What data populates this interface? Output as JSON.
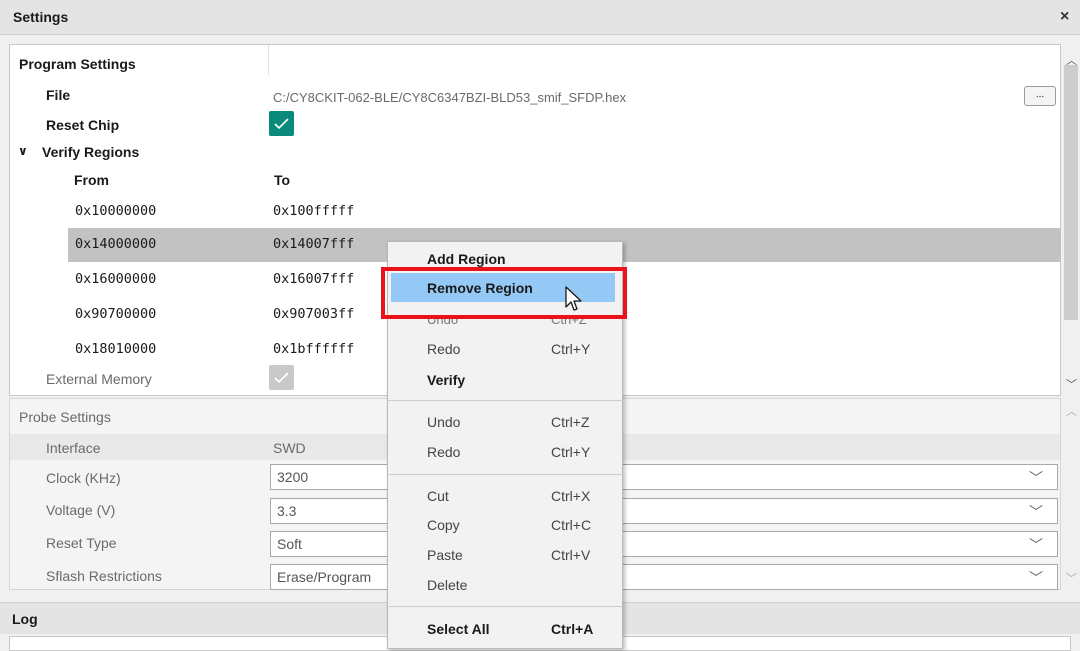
{
  "settings_panel": {
    "title": "Settings",
    "close_glyph": "×"
  },
  "program_settings": {
    "header": "Program Settings",
    "file_label": "File",
    "file_path": "C:/CY8CKIT-062-BLE/CY8C6347BZI-BLD53_smif_SFDP.hex",
    "browse_label": "...",
    "reset_chip_label": "Reset Chip",
    "reset_chip_checked": true,
    "verify_regions_label": "Verify Regions",
    "expand_glyph": "∨",
    "from_header": "From",
    "to_header": "To",
    "regions": [
      {
        "from": "0x10000000",
        "to": "0x100fffff"
      },
      {
        "from": "0x14000000",
        "to": "0x14007fff"
      },
      {
        "from": "0x16000000",
        "to": "0x16007fff"
      },
      {
        "from": "0x90700000",
        "to": "0x907003ff"
      },
      {
        "from": "0x18010000",
        "to": "0x1bffffff"
      }
    ],
    "selected_region_index": 1,
    "external_memory_label": "External Memory",
    "external_memory_checked": true
  },
  "probe_settings": {
    "header": "Probe Settings",
    "interface_label": "Interface",
    "interface_value": "SWD",
    "clock_label": "Clock (KHz)",
    "clock_value": "3200",
    "voltage_label": "Voltage (V)",
    "voltage_value": "3.3",
    "reset_type_label": "Reset Type",
    "reset_type_value": "Soft",
    "sflash_label": "Sflash Restrictions",
    "sflash_value": "Erase/Program"
  },
  "log_panel": {
    "title": "Log"
  },
  "context_menu": {
    "add_region": "Add Region",
    "remove_region": "Remove Region",
    "undo_obscured": "Undo",
    "undo_obscured_shortcut": "Ctrl+Z",
    "redo_1": "Redo",
    "redo_1_shortcut": "Ctrl+Y",
    "verify": "Verify",
    "undo": "Undo",
    "undo_shortcut": "Ctrl+Z",
    "redo_2": "Redo",
    "redo_2_shortcut": "Ctrl+Y",
    "cut": "Cut",
    "cut_shortcut": "Ctrl+X",
    "copy": "Copy",
    "copy_shortcut": "Ctrl+C",
    "paste": "Paste",
    "paste_shortcut": "Ctrl+V",
    "delete": "Delete",
    "select_all": "Select All",
    "select_all_shortcut": "Ctrl+A",
    "highlighted_item": "Remove Region"
  },
  "colors": {
    "checkbox_accent": "#0a8a7a",
    "menu_highlight": "#94c9f5",
    "annotation_red": "#e8141a",
    "selected_row": "#c2c2c2"
  },
  "icons": [
    "close-icon",
    "checkmark-icon",
    "chevron-down-icon",
    "scroll-up-icon",
    "scroll-down-icon",
    "mouse-pointer-icon"
  ]
}
